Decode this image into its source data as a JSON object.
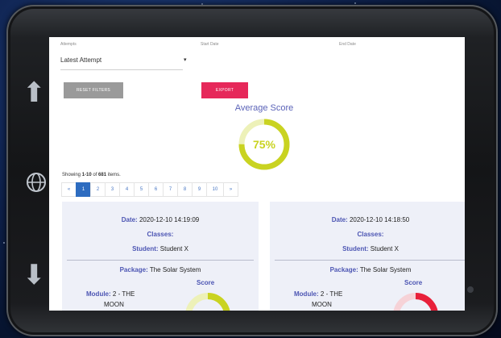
{
  "filters": {
    "attempts_label": "Attempts",
    "start_date_label": "Start Date",
    "end_date_label": "End Date",
    "attempt_value": "Latest Attempt"
  },
  "buttons": {
    "reset": "RESET FILTERS",
    "export": "EXPORT"
  },
  "summary": {
    "title": "Average Score",
    "value": "75%",
    "percent": 75,
    "color": "#c9d321",
    "track_color": "#edf1b8"
  },
  "results": {
    "prefix": "Showing ",
    "range": "1-10",
    "of": " of ",
    "total": "681",
    "suffix": " items."
  },
  "pagination": {
    "prev": "«",
    "pages": [
      "1",
      "2",
      "3",
      "4",
      "5",
      "6",
      "7",
      "8",
      "9",
      "10"
    ],
    "next": "»",
    "active": "1"
  },
  "labels": {
    "date": "Date:",
    "classes": "Classes:",
    "student": "Student:",
    "package": "Package:",
    "module": "Module:",
    "score": "Score"
  },
  "cards": [
    {
      "date": "2020-12-10 14:19:09",
      "student": "Student X",
      "package": "The Solar System",
      "module_line1": "2 - THE",
      "module_line2": "MOON",
      "score_color": "#c9d321"
    },
    {
      "date": "2020-12-10 14:18:50",
      "student": "Student X",
      "package": "The Solar System",
      "module_line1": "2 - THE",
      "module_line2": "MOON",
      "score_color": "#e8203a"
    }
  ],
  "icons": {
    "up": "arrow-up-icon",
    "down": "arrow-down-icon",
    "globe": "globe-icon"
  }
}
